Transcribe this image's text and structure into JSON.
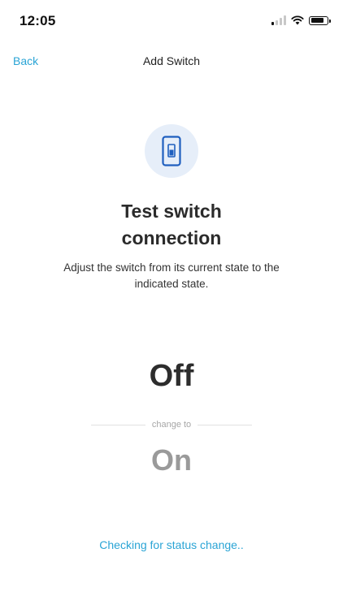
{
  "status_bar": {
    "time": "12:05",
    "icons": [
      "cellular-signal-icon",
      "wifi-icon",
      "battery-icon"
    ]
  },
  "nav": {
    "back_label": "Back",
    "title": "Add Switch"
  },
  "hero": {
    "icon": "light-switch-icon",
    "icon_color": "#1f5fbf",
    "icon_bg_color": "#e6eef9",
    "heading_line1": "Test switch",
    "heading_line2": "connection",
    "description": "Adjust the switch from its current state to the indicated state."
  },
  "switch_test": {
    "current_state": "Off",
    "change_label": "change to",
    "target_state": "On"
  },
  "status_message": "Checking for status change..",
  "colors": {
    "accent": "#2aa4d5",
    "target_state": "#9a9a9a"
  }
}
